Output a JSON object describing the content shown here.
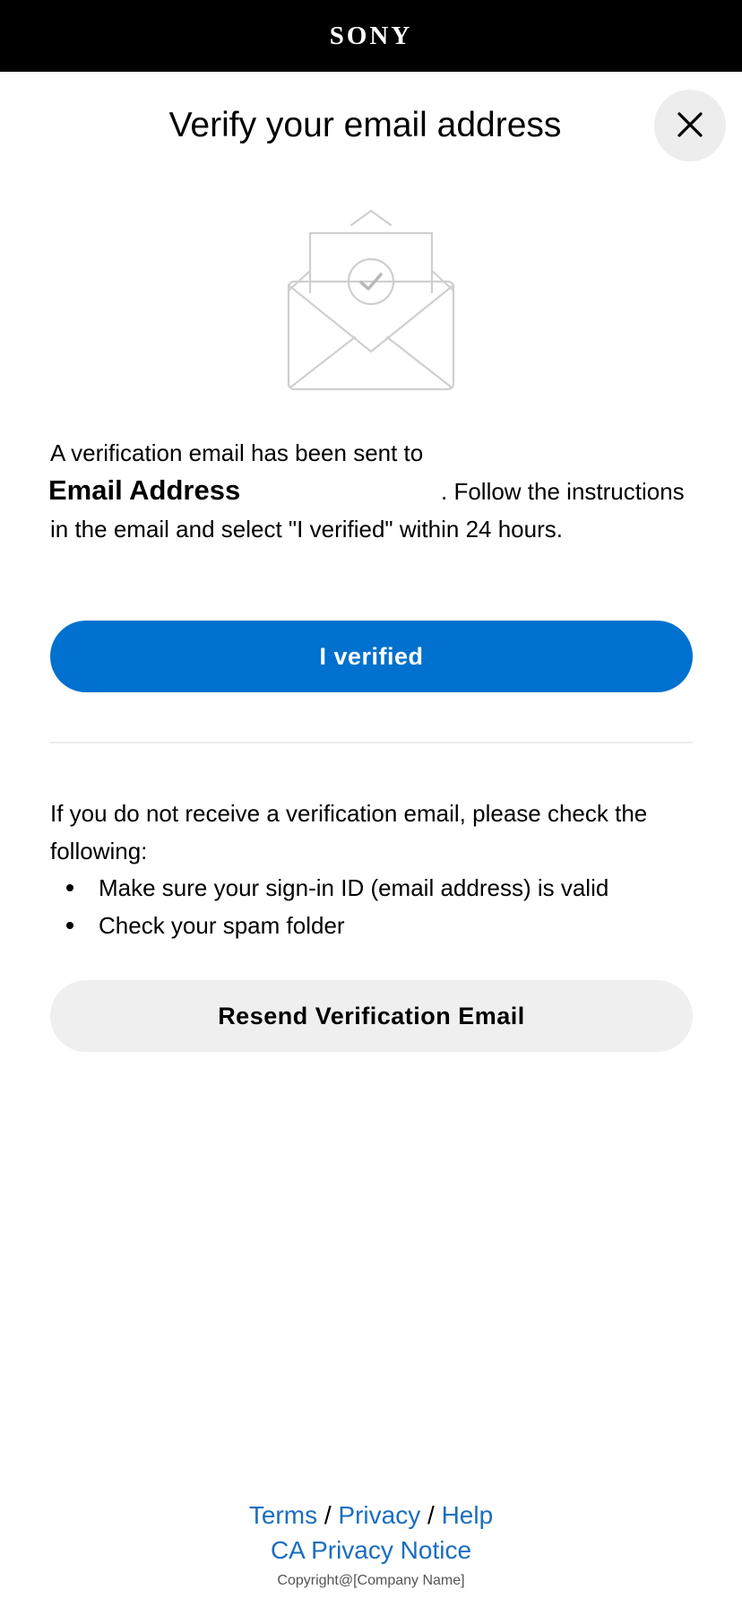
{
  "header": {
    "brand": "SONY",
    "background_color": "#000000"
  },
  "dialog": {
    "title": "Verify your email address",
    "close_icon": "close-icon",
    "illustration_icon": "envelope-check-icon"
  },
  "message": {
    "intro": "A verification email has been sent to",
    "email": "Email Address",
    "suffix": ". Follow the instructions in the email and select \"I verified\" within 24 hours."
  },
  "primary_button": {
    "label": "I verified",
    "color": "#0071ce"
  },
  "help": {
    "intro": "If you do not receive a verification email, please check the following:",
    "items": [
      "Make sure your sign-in ID (email address) is valid",
      "Check your spam folder"
    ]
  },
  "secondary_button": {
    "label": "Resend Verification Email",
    "color": "#efefef"
  },
  "footer": {
    "terms": "Terms",
    "privacy": "Privacy",
    "help": "Help",
    "separator": " / ",
    "ca_notice": "CA Privacy Notice",
    "copyright": "Copyright@[Company Name]",
    "link_color": "#1a6ebf"
  }
}
